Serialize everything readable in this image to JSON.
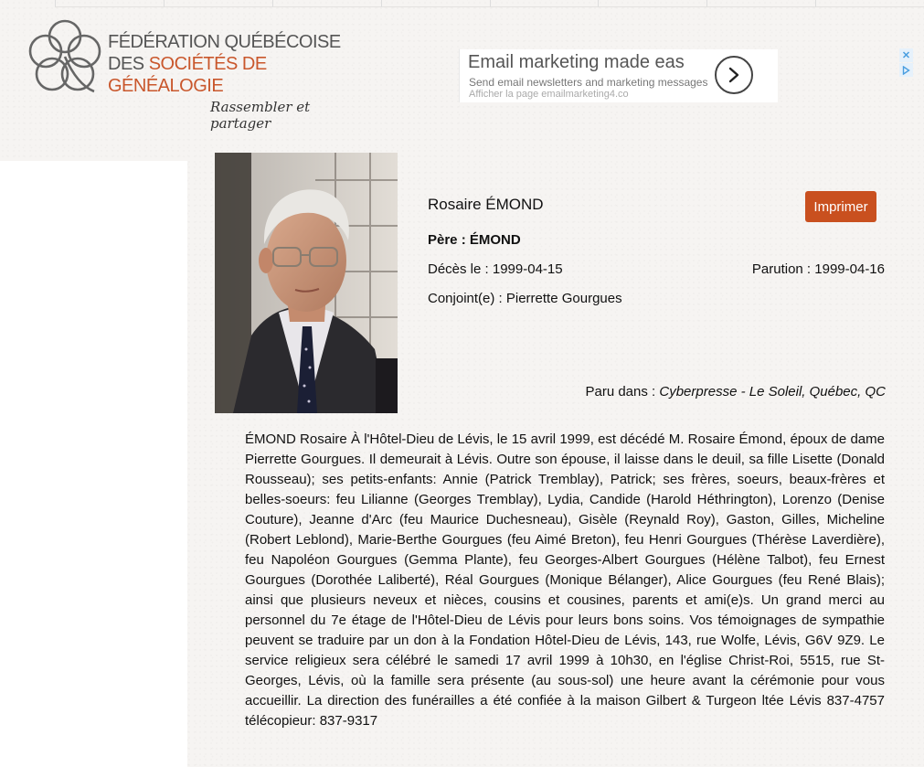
{
  "header": {
    "logo_line1": "FÉDÉRATION QUÉBÉCOISE",
    "logo_line2_prefix": "DES ",
    "logo_line2_accent": "SOCIÉTÉS DE GÉNÉALOGIE",
    "logo_tagline": "Rassembler et partager"
  },
  "ad": {
    "title": "Email marketing made eas",
    "subtitle": "Send email newsletters and marketing messages",
    "url": "Afficher la page emailmarketing4.co",
    "arrow_icon": "chevron-right-icon",
    "close_label": "✕"
  },
  "record": {
    "name": "Rosaire ÉMOND",
    "print_label": "Imprimer",
    "father": "Père : ÉMOND",
    "deces_label": "Décès le : ",
    "deces_date": "1999-04-15",
    "parution_label": "Parution : ",
    "parution_date": "1999-04-16",
    "conjoint_label": "Conjoint(e) : ",
    "conjoint": "Pierrette Gourgues",
    "paru_label": "Paru dans : ",
    "paru_source": "Cyberpresse - Le Soleil, Québec, QC",
    "obituary": "ÉMOND Rosaire À l'Hôtel-Dieu de Lévis, le 15 avril 1999, est décédé M. Rosaire Émond, époux de dame Pierrette Gourgues. Il demeurait à Lévis. Outre son épouse, il laisse dans le deuil, sa fille Lisette (Donald Rousseau); ses petits-enfants: Annie (Patrick Tremblay), Patrick; ses frères, soeurs, beaux-frères et belles-soeurs: feu Lilianne (Georges Tremblay), Lydia, Candide (Harold Héthrington), Lorenzo (Denise Couture), Jeanne d'Arc (feu Maurice Duchesneau), Gisèle (Reynald Roy), Gaston, Gilles, Micheline (Robert Leblond), Marie-Berthe Gourgues (feu Aimé Breton), feu Henri Gourgues (Thérèse Laverdière), feu Napoléon Gourgues (Gemma Plante), feu Georges-Albert Gourgues (Hélène Talbot), feu Ernest Gourgues (Dorothée Laliberté), Réal Gourgues (Monique Bélanger), Alice Gourgues (feu René Blais); ainsi que plusieurs neveux et nièces, cousins et cousines, parents et ami(e)s. Un grand merci au personnel du 7e étage de l'Hôtel-Dieu de Lévis pour leurs bons soins. Vos témoignages de sympathie peuvent se traduire par un don à la Fondation Hôtel-Dieu de Lévis, 143, rue Wolfe, Lévis, G6V 9Z9. Le service religieux sera célébré le samedi 17 avril 1999 à 10h30, en l'église Christ-Roi, 5515, rue St-Georges, Lévis, où la famille sera présente (au sous-sol) une heure avant la cérémonie pour vous accueillir. La direction des funérailles a été confiée à la maison Gilbert & Turgeon ltée Lévis 837-4757 télécopieur: 837-9317"
  },
  "colors": {
    "accent": "#c9572c",
    "button": "#c9501f"
  }
}
